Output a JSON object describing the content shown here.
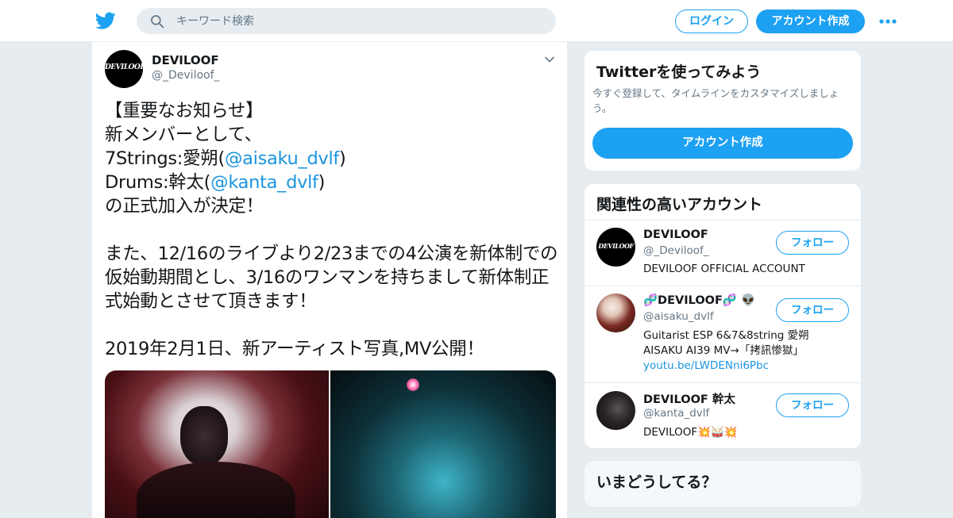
{
  "header": {
    "search_placeholder": "キーワード検索",
    "login_label": "ログイン",
    "signup_label": "アカウント作成"
  },
  "tweet": {
    "name": "DEVILOOF",
    "handle": "@_Deviloof_",
    "line1": "【重要なお知らせ】",
    "line2": "新メンバーとして、",
    "line3_prefix": "7Strings:愛朔(",
    "line3_mention": "@aisaku_dvlf",
    "line3_suffix": ")",
    "line4_prefix": "Drums:幹太(",
    "line4_mention": "@kanta_dvlf",
    "line4_suffix": ")",
    "line5": "の正式加入が決定！",
    "line6": "また、12/16のライブより2/23までの4公演を新体制での仮始動期間とし、3/16のワンマンを持ちまして新体制正式始動とさせて頂きます！",
    "line7": "2019年2月1日、新アーティスト写真,MV公開！"
  },
  "signup_card": {
    "title": "Twitterを使ってみよう",
    "description": "今すぐ登録して、タイムラインをカスタマイズしましょう。",
    "button_label": "アカウント作成"
  },
  "related": {
    "title": "関連性の高いアカウント",
    "accounts": [
      {
        "name": "DEVILOOF",
        "handle": "@_Deviloof_",
        "bio": "DEVILOOF OFFICIAL ACCOUNT",
        "follow_label": "フォロー"
      },
      {
        "name": "🧬DEVILOOF🧬 👽",
        "handle": "@aisaku_dvlf",
        "bio": "Guitarist ESP 6&7&8string 愛朔 AISAKU AI39 MV→「拷訊惨獄」",
        "bio_link": "youtu.be/LWDENni6Pbc",
        "follow_label": "フォロー"
      },
      {
        "name": "DEVILOOF 幹太",
        "handle": "@kanta_dvlf",
        "bio": "DEVILOOF💥🥁💥",
        "follow_label": "フォロー"
      }
    ]
  },
  "whats_happening": {
    "title": "いまどうしてる？"
  },
  "colors": {
    "accent": "#1da1f2",
    "link": "#1b95e0",
    "muted": "#657786",
    "background": "#e6ecf0"
  },
  "icons": [
    "twitter-bird-icon",
    "search-icon",
    "more-icon",
    "chevron-down-icon"
  ]
}
